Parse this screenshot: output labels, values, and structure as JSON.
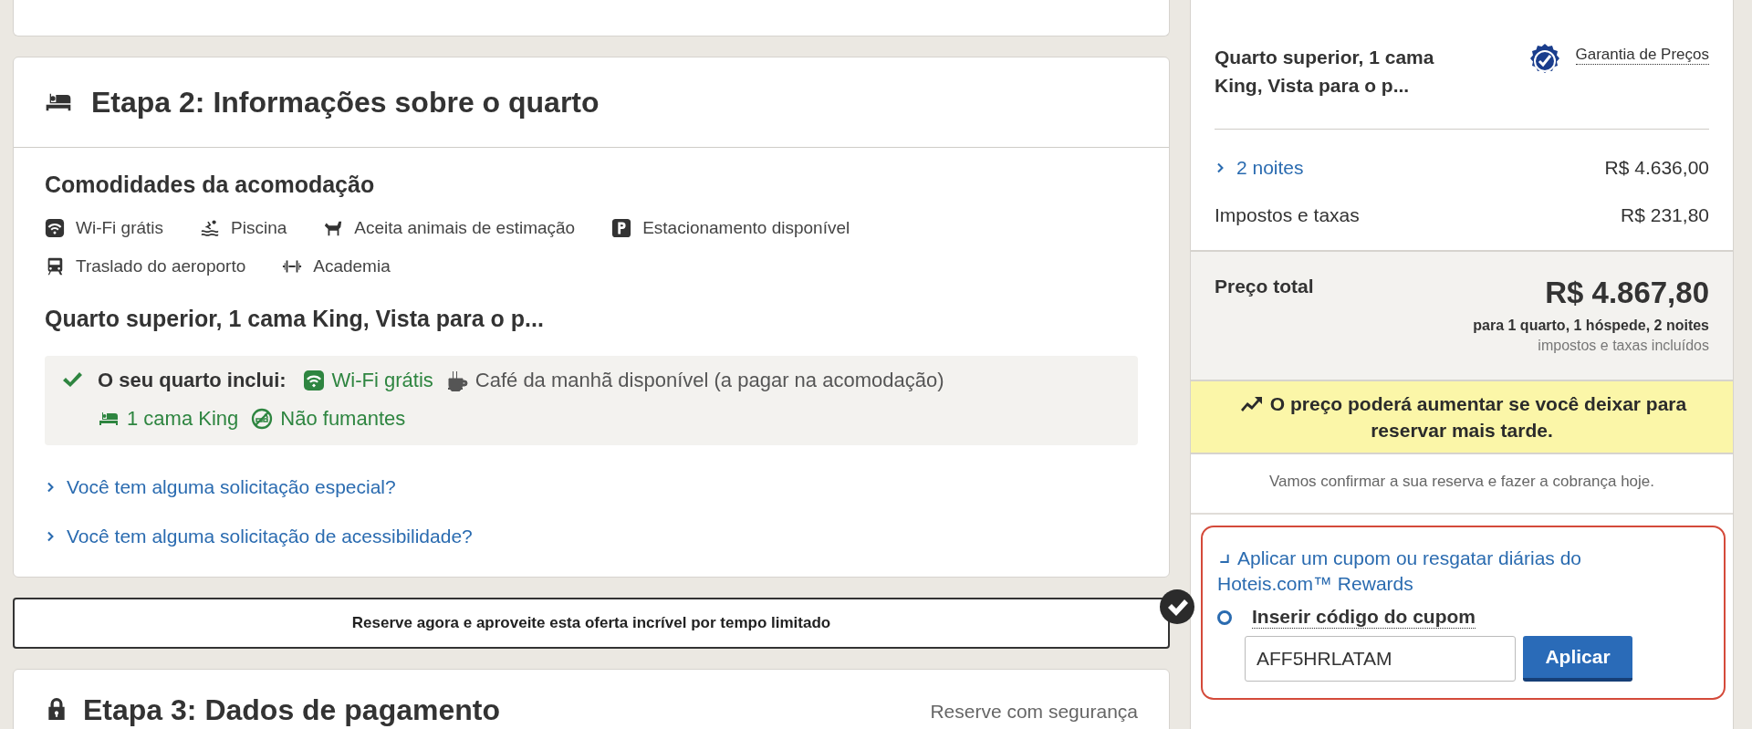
{
  "room_step": {
    "title": "Etapa 2: Informações sobre o quarto",
    "amenities_heading": "Comodidades da acomodação",
    "amenities": [
      "Wi-Fi grátis",
      "Piscina",
      "Aceita animais de estimação",
      "Estacionamento disponível",
      "Traslado do aeroporto",
      "Academia"
    ],
    "room_name": "Quarto superior, 1 cama King, Vista para o p...",
    "includes": {
      "label": "O seu quarto inclui:",
      "items": [
        {
          "text": "Wi-Fi grátis",
          "highlighted": true
        },
        {
          "text": "Café da manhã disponível (a pagar na acomodação)",
          "highlighted": false
        },
        {
          "text": "1 cama King",
          "highlighted": true
        },
        {
          "text": "Não fumantes",
          "highlighted": true
        }
      ]
    },
    "links": [
      "Você tem alguma solicitação especial?",
      "Você tem alguma solicitação de acessibilidade?"
    ]
  },
  "offer_banner": {
    "text": "Reserve agora e aproveite esta oferta incrível por tempo limitado",
    "checked": true
  },
  "payment_step": {
    "title": "Etapa 3: Dados de pagamento",
    "note": "Reserve com segurança"
  },
  "summary": {
    "room_name": "Quarto superior, 1 cama King, Vista para o p...",
    "guarantee": "Garantia de Preços",
    "lines": [
      {
        "label": "2 noites",
        "amount": "R$ 4.636,00",
        "expandable": true
      },
      {
        "label": "Impostos e taxas",
        "amount": "R$ 231,80",
        "expandable": false
      }
    ],
    "total_label": "Preço total",
    "total": "R$ 4.867,80",
    "total_detail": "para 1 quarto, 1 hóspede, 2 noites",
    "total_note": "impostos e taxas incluídos",
    "price_alert": "O preço poderá aumentar se você deixar para reservar mais tarde.",
    "confirm_note": "Vamos confirmar a sua reserva e fazer a cobrança hoje.",
    "coupon": {
      "toggle": "Aplicar um cupom ou resgatar diárias do Hoteis.com™ Rewards",
      "expanded": true,
      "option": {
        "label": "Inserir código do cupom",
        "selected": true
      },
      "value": "AFF5HRLATAM",
      "button": "Aplicar"
    }
  }
}
